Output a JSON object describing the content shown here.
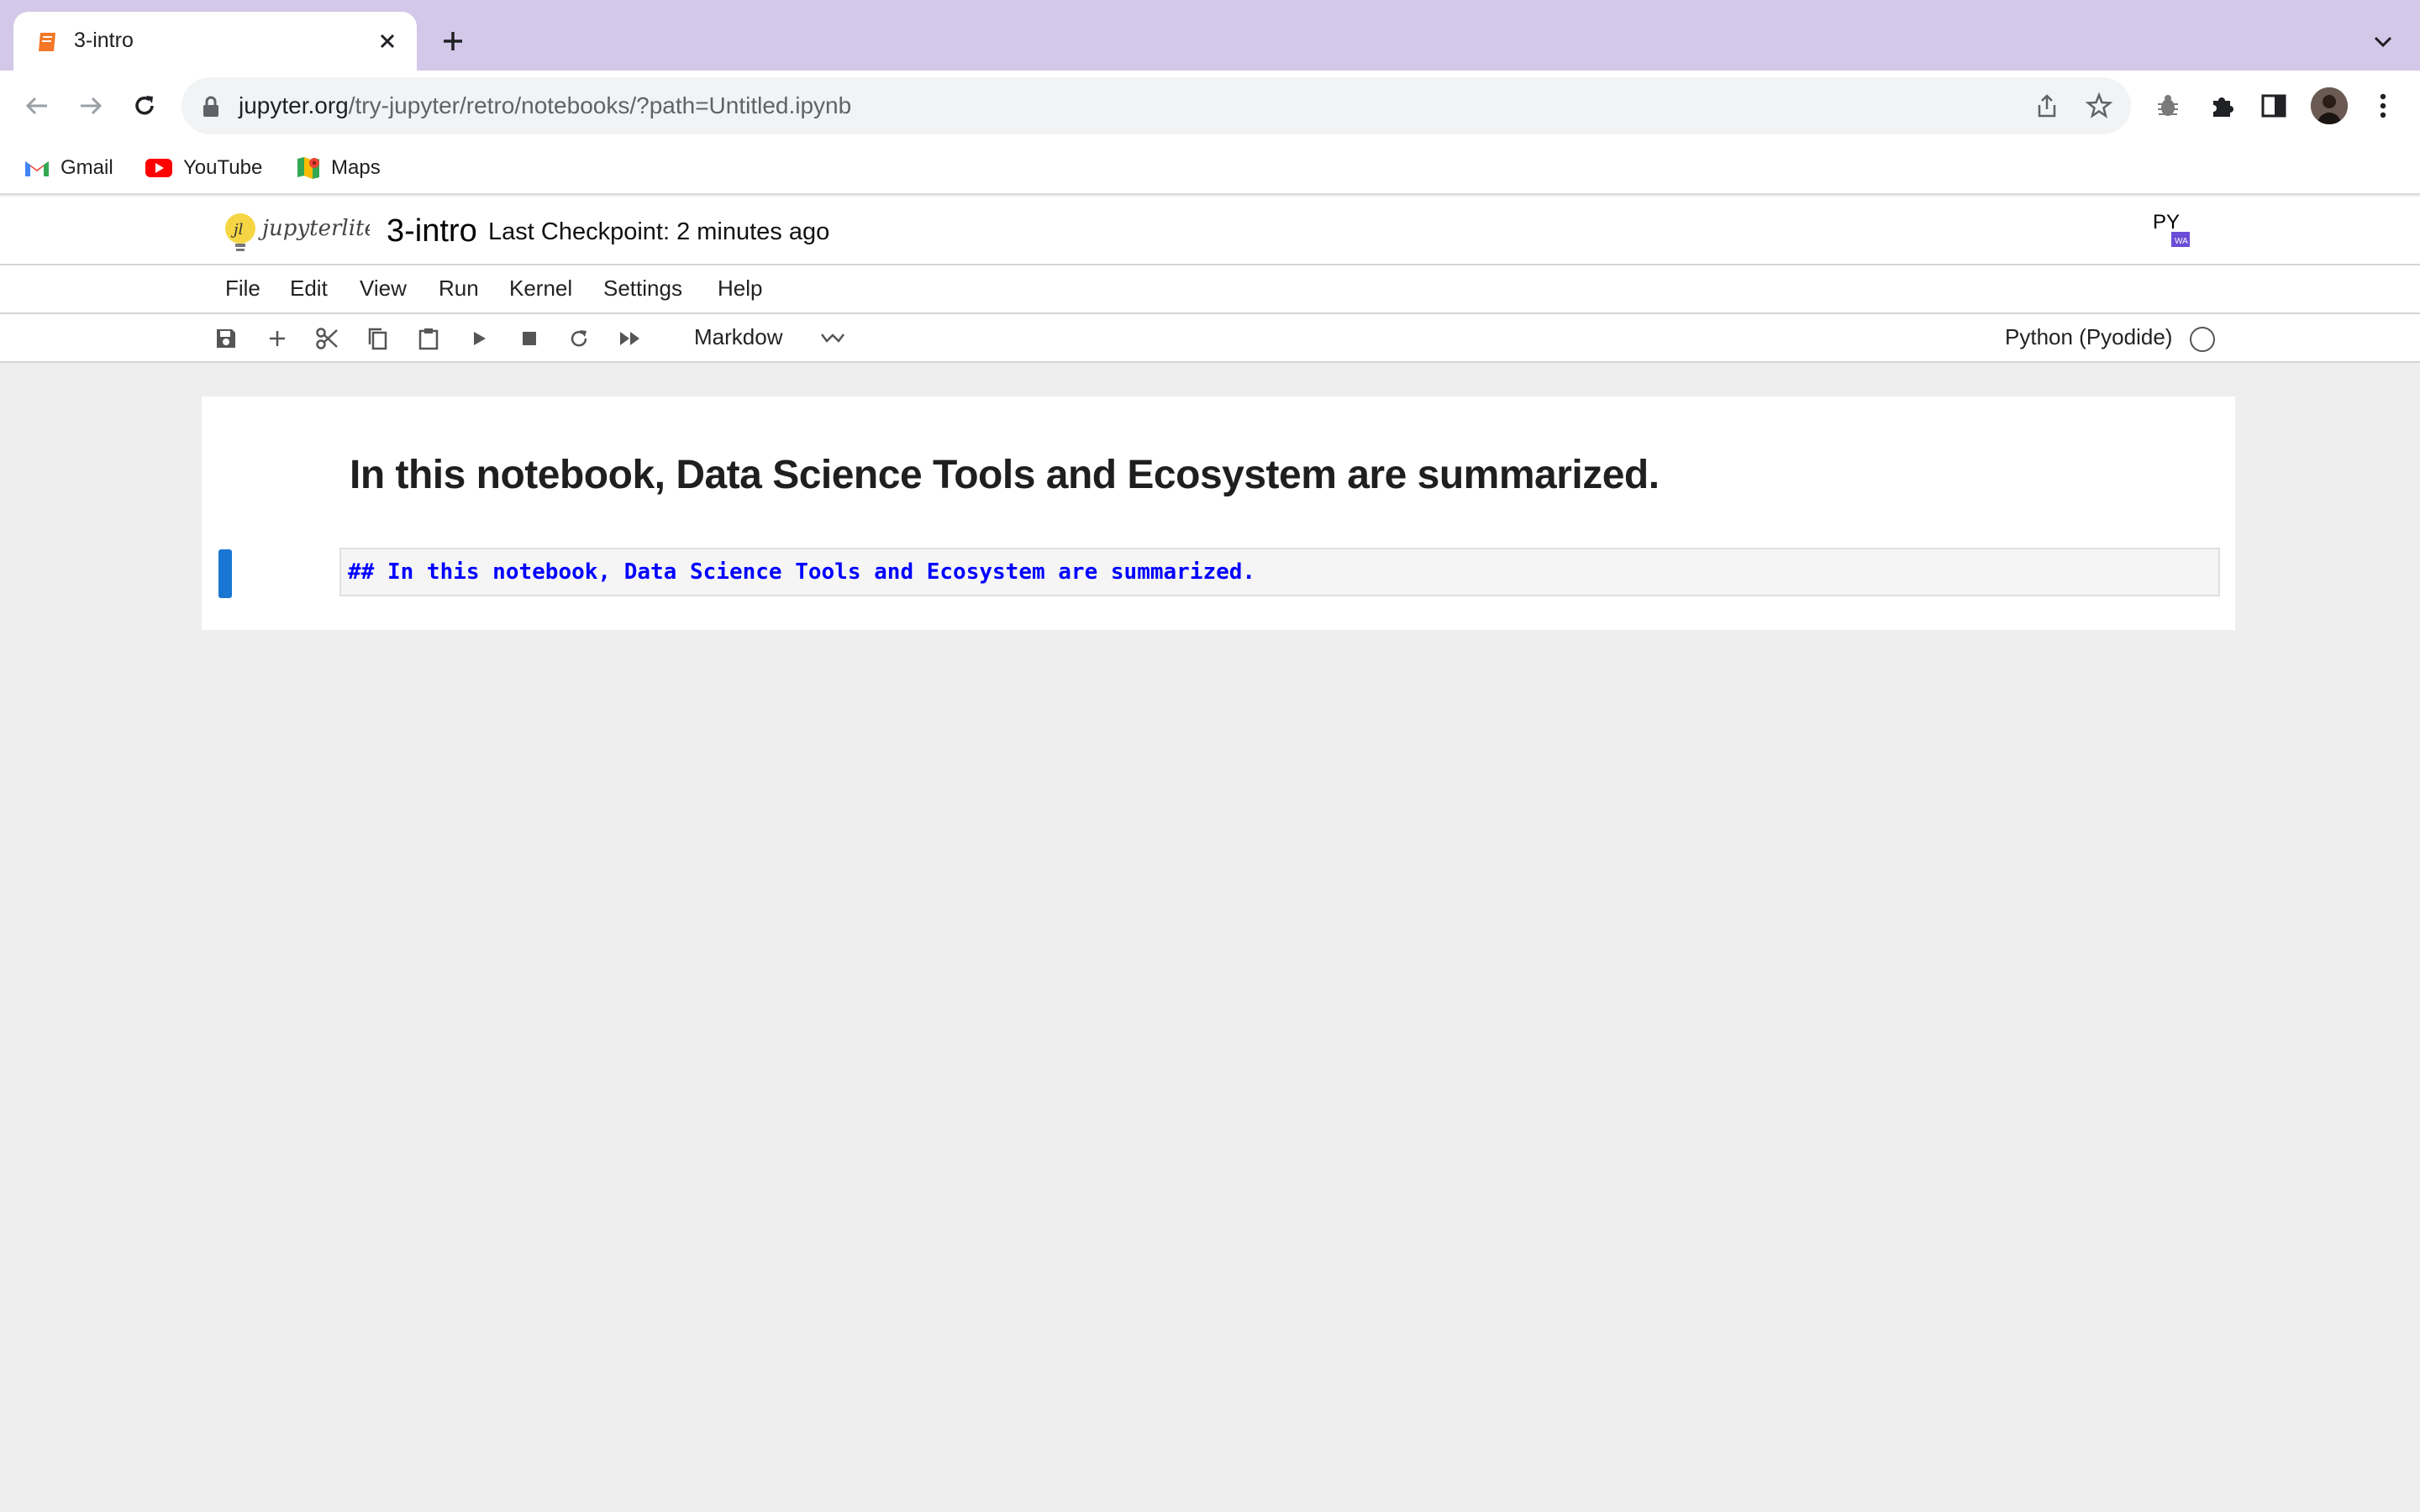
{
  "browser": {
    "tab_title": "3-intro",
    "url_host": "jupyter.org",
    "url_path": "/try-jupyter/retro/notebooks/?path=Untitled.ipynb",
    "bookmarks": [
      {
        "label": "Gmail",
        "icon": "gmail-icon"
      },
      {
        "label": "YouTube",
        "icon": "youtube-icon"
      },
      {
        "label": "Maps",
        "icon": "maps-icon"
      }
    ]
  },
  "notebook": {
    "logo_text": "jupyterlite",
    "title": "3-intro",
    "checkpoint": "Last Checkpoint: 2 minutes ago",
    "menu": [
      "File",
      "Edit",
      "View",
      "Run",
      "Kernel",
      "Settings",
      "Help"
    ],
    "toolbar_icons": [
      "save-icon",
      "add-cell-icon",
      "cut-icon",
      "copy-icon",
      "paste-icon",
      "run-icon",
      "stop-icon",
      "restart-icon",
      "fast-forward-icon"
    ],
    "cell_type": "Markdow",
    "kernel_name": "Python (Pyodide)",
    "kernel_status": "idle",
    "cells": [
      {
        "rendered": "In this notebook, Data Science Tools and Ecosystem are summarized.",
        "source": "## In this notebook, Data Science Tools and Ecosystem are summarized."
      }
    ]
  },
  "colors": {
    "tabstrip": "#d3c8e8",
    "accent_blue": "#1976d2",
    "markdown_source": "#0000ff"
  }
}
